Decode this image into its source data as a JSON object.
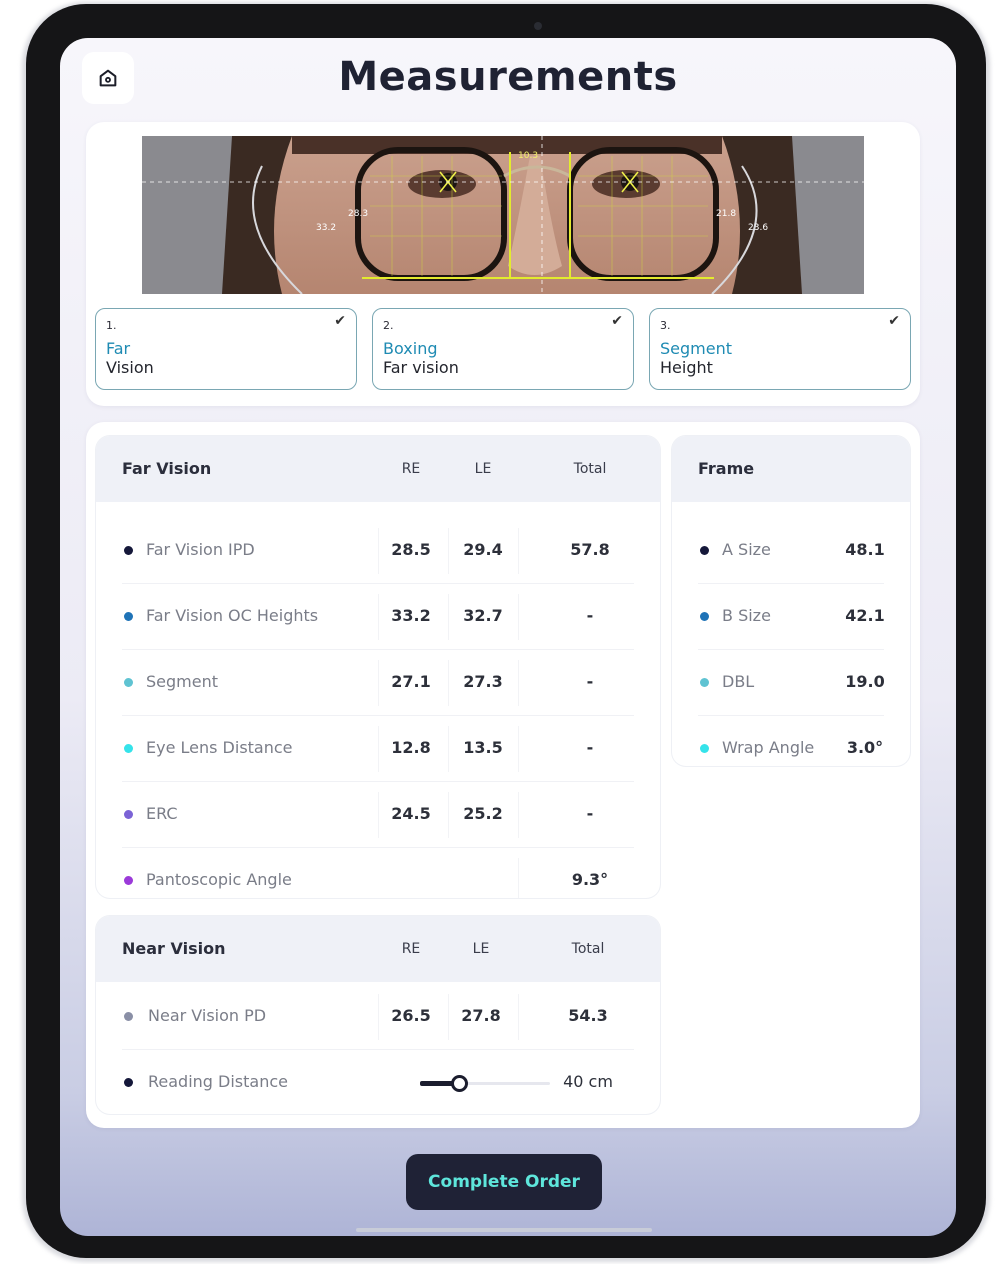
{
  "header": {
    "title": "Measurements"
  },
  "photo_overlay": {
    "labels": [
      "10.3",
      "33.2",
      "28.3",
      "21.8",
      "23.6"
    ]
  },
  "steps": [
    {
      "num": "1.",
      "line1": "Far",
      "line2": "Vision"
    },
    {
      "num": "2.",
      "line1": "Boxing",
      "line2": "Far vision"
    },
    {
      "num": "3.",
      "line1": "Segment",
      "line2": "Height"
    }
  ],
  "far_vision": {
    "columns": {
      "title": "Far Vision",
      "re": "RE",
      "le": "LE",
      "total": "Total"
    },
    "rows": [
      {
        "label": "Far Vision IPD",
        "re": "28.5",
        "le": "29.4",
        "total": "57.8",
        "color": "#15183a"
      },
      {
        "label": "Far Vision OC Heights",
        "re": "33.2",
        "le": "32.7",
        "total": "-",
        "color": "#1f73b7"
      },
      {
        "label": "Segment",
        "re": "27.1",
        "le": "27.3",
        "total": "-",
        "color": "#5fc3d2"
      },
      {
        "label": "Eye Lens Distance",
        "re": "12.8",
        "le": "13.5",
        "total": "-",
        "color": "#35e3ea"
      },
      {
        "label": "ERC",
        "re": "24.5",
        "le": "25.2",
        "total": "-",
        "color": "#7b63d6"
      },
      {
        "label": "Pantoscopic Angle",
        "re": "",
        "le": "",
        "total": "9.3°",
        "color": "#9b3ad9"
      }
    ]
  },
  "frame": {
    "title": "Frame",
    "rows": [
      {
        "label": "A Size",
        "value": "48.1",
        "color": "#15183a"
      },
      {
        "label": "B Size",
        "value": "42.1",
        "color": "#1f73b7"
      },
      {
        "label": "DBL",
        "value": "19.0",
        "color": "#5fc3d2"
      },
      {
        "label": "Wrap Angle",
        "value": "3.0°",
        "color": "#35e3ea"
      }
    ]
  },
  "near_vision": {
    "columns": {
      "title": "Near Vision",
      "re": "RE",
      "le": "LE",
      "total": "Total"
    },
    "near_pd": {
      "label": "Near Vision PD",
      "re": "26.5",
      "le": "27.8",
      "total": "54.3",
      "color": "#8a8fa6"
    },
    "reading": {
      "label": "Reading Distance",
      "value": "40 cm",
      "slider_fraction": 0.3,
      "color": "#15183a"
    }
  },
  "footer": {
    "complete_label": "Complete Order"
  }
}
